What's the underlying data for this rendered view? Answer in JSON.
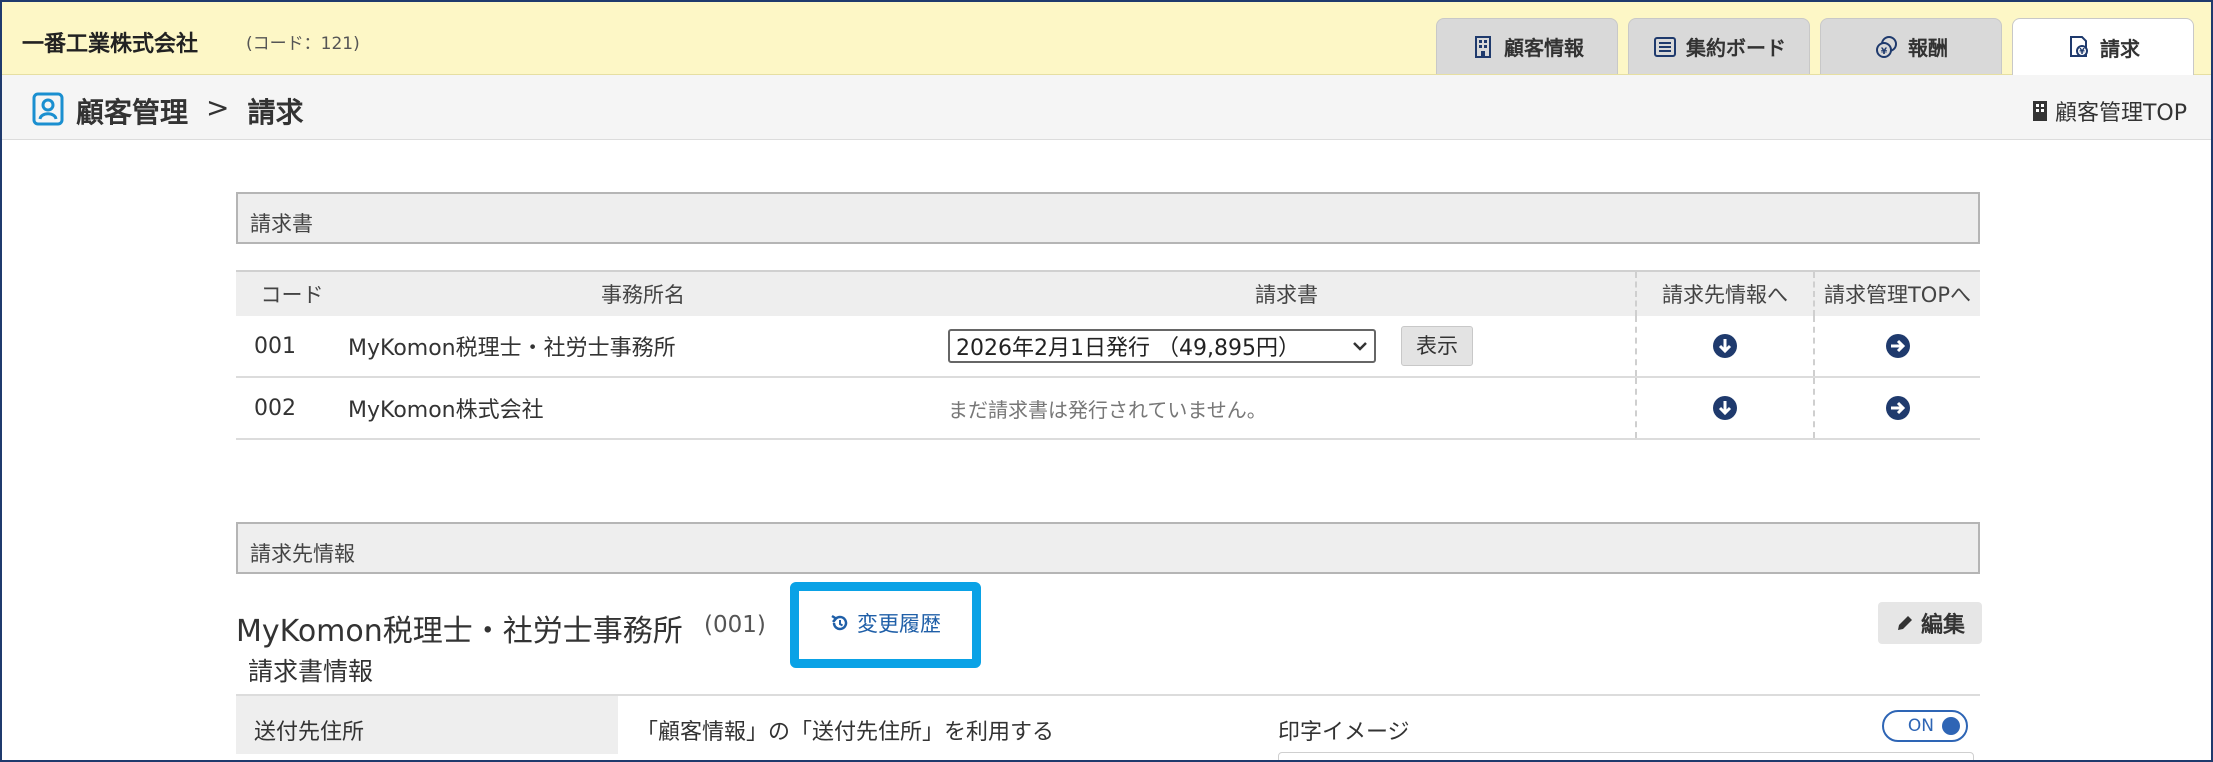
{
  "header": {
    "company_name": "一番工業株式会社",
    "company_code": "(コード：121)",
    "tabs": [
      {
        "label": "顧客情報",
        "icon": "building-icon",
        "active": false
      },
      {
        "label": "集約ボード",
        "icon": "board-icon",
        "active": false
      },
      {
        "label": "報酬",
        "icon": "coins-icon",
        "active": false
      },
      {
        "label": "請求",
        "icon": "invoice-icon",
        "active": true
      }
    ]
  },
  "breadcrumb": {
    "root": "顧客管理",
    "separator": ">",
    "current": "請求",
    "top_link": "顧客管理TOP"
  },
  "invoice_section": {
    "title": "請求書",
    "columns": [
      "コード",
      "事務所名",
      "請求書",
      "請求先情報へ",
      "請求管理TOPへ"
    ],
    "rows": [
      {
        "code": "001",
        "office": "MyKomon税理士・社労士事務所",
        "invoice_select": "2026年2月1日発行 （49,895円）",
        "show_button": "表示",
        "no_invoice": ""
      },
      {
        "code": "002",
        "office": "MyKomon株式会社",
        "invoice_select": "",
        "show_button": "",
        "no_invoice": "まだ請求書は発行されていません。"
      }
    ]
  },
  "billing_section": {
    "title": "請求先情報",
    "client_name": "MyKomon税理士・社労士事務所",
    "client_code": "(001)",
    "history_button": "変更履歴",
    "edit_button": "編集",
    "subheading": "請求書情報",
    "send_address_label": "送付先住所",
    "send_address_value": "「顧客情報」の「送付先住所」を利用する",
    "print_image_label": "印字イメージ",
    "toggle_label": "ON",
    "toggle_state": "on"
  },
  "colors": {
    "header_bg": "#fdf7c6",
    "highlight_border": "#0aa2e6",
    "link_blue": "#1f5fa8",
    "icon_navy": "#1f3a6d"
  }
}
